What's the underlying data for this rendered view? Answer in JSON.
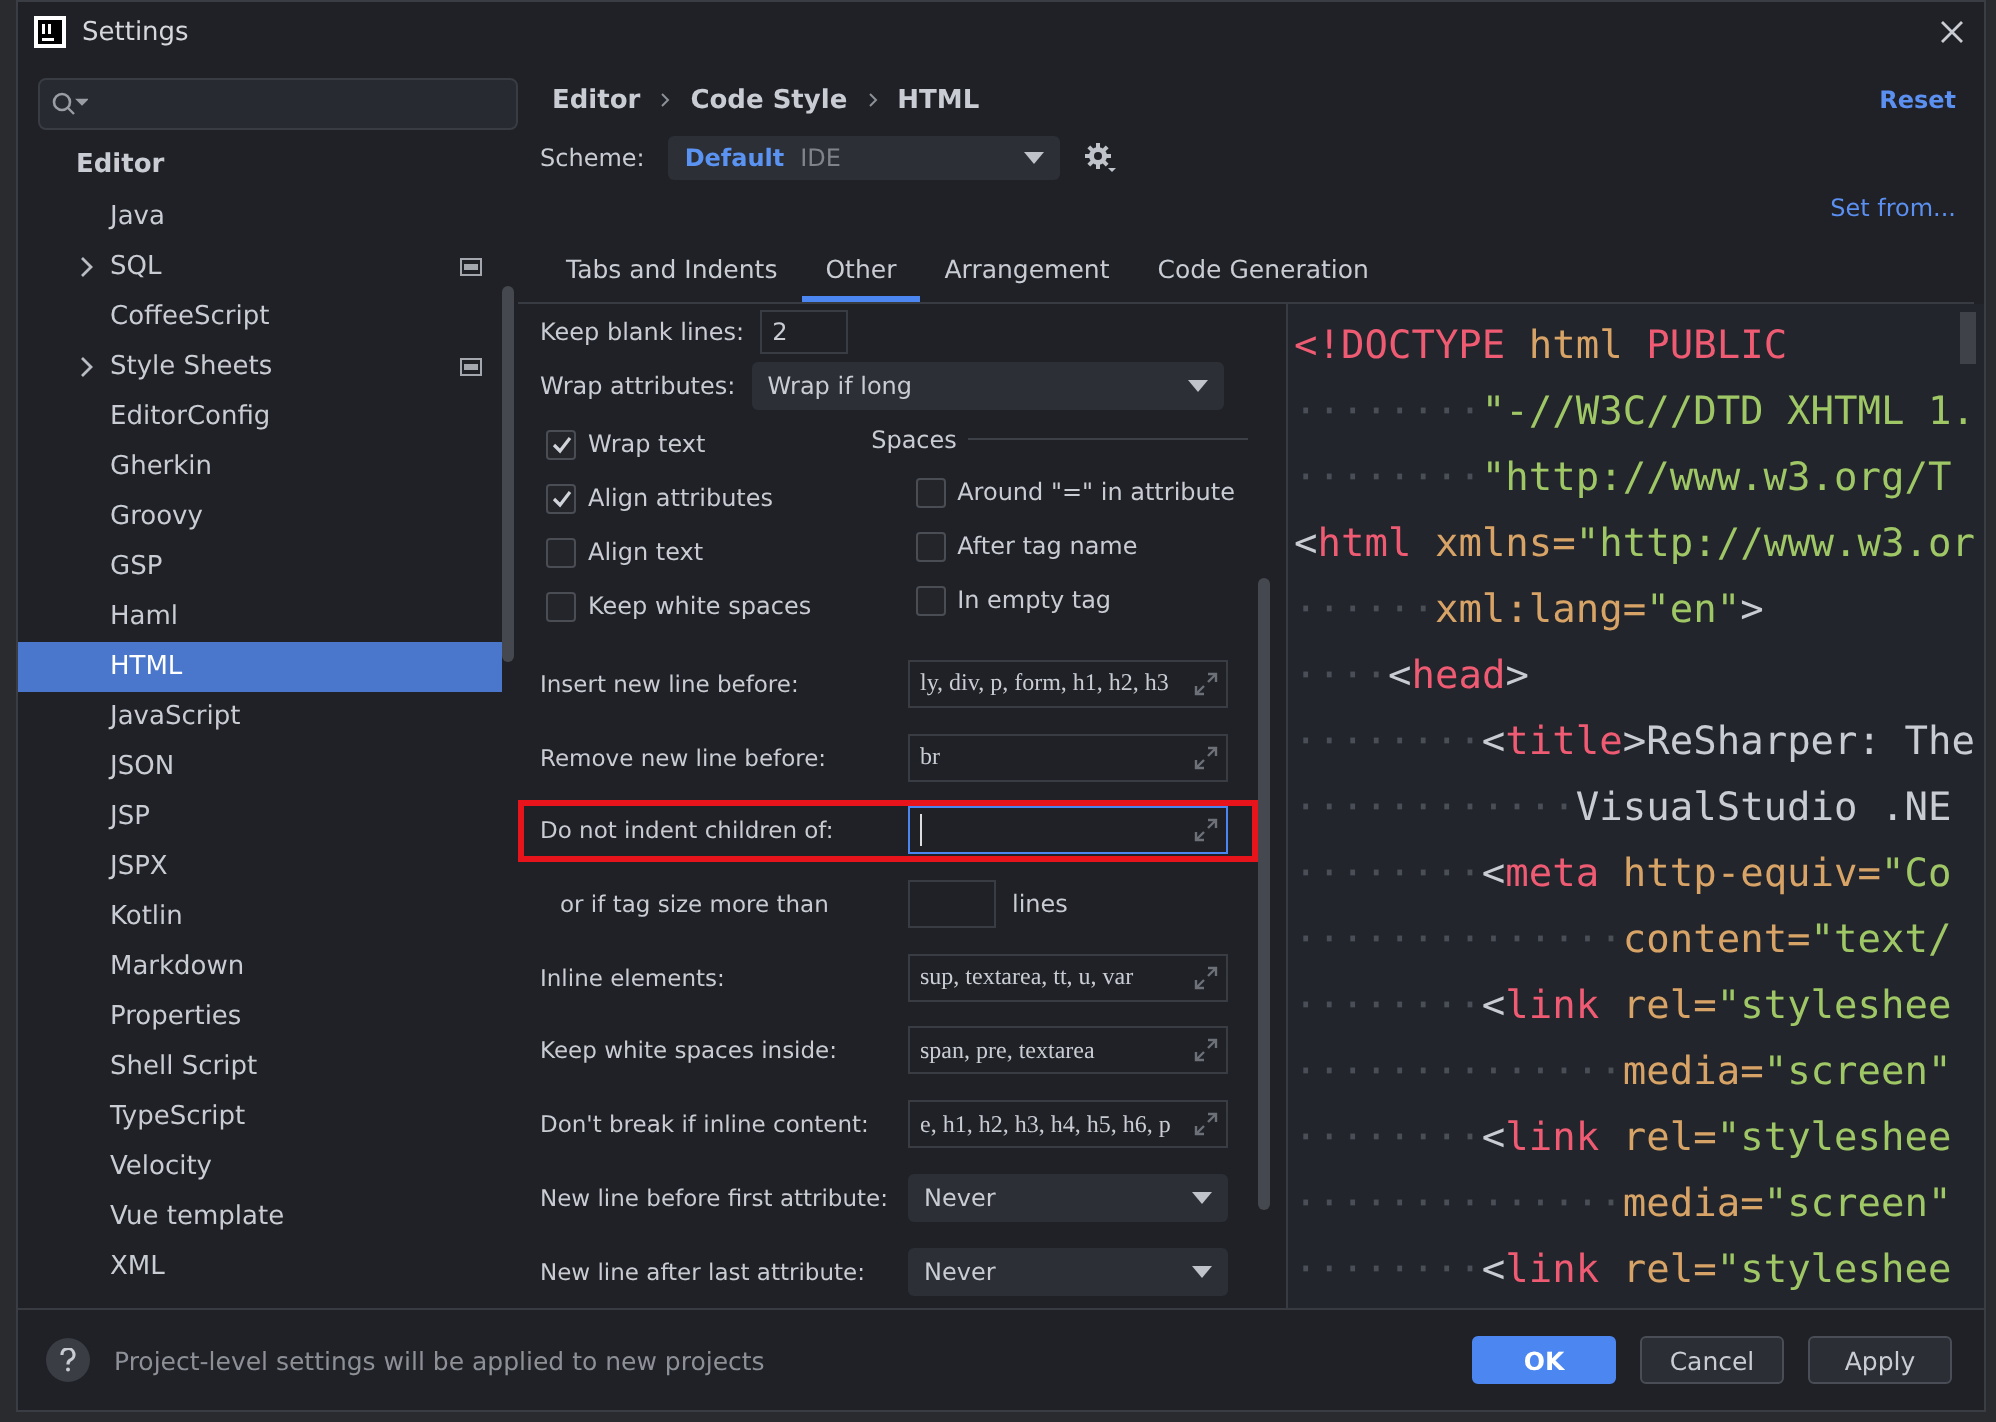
{
  "window": {
    "title": "Settings"
  },
  "sidebar": {
    "section": "Editor",
    "items": [
      {
        "label": "Java",
        "expandable": false,
        "project_scoped": false,
        "selected": false
      },
      {
        "label": "SQL",
        "expandable": true,
        "project_scoped": true,
        "selected": false
      },
      {
        "label": "CoffeeScript",
        "expandable": false,
        "project_scoped": false,
        "selected": false
      },
      {
        "label": "Style Sheets",
        "expandable": true,
        "project_scoped": true,
        "selected": false
      },
      {
        "label": "EditorConfig",
        "expandable": false,
        "project_scoped": false,
        "selected": false
      },
      {
        "label": "Gherkin",
        "expandable": false,
        "project_scoped": false,
        "selected": false
      },
      {
        "label": "Groovy",
        "expandable": false,
        "project_scoped": false,
        "selected": false
      },
      {
        "label": "GSP",
        "expandable": false,
        "project_scoped": false,
        "selected": false
      },
      {
        "label": "Haml",
        "expandable": false,
        "project_scoped": false,
        "selected": false
      },
      {
        "label": "HTML",
        "expandable": false,
        "project_scoped": false,
        "selected": true
      },
      {
        "label": "JavaScript",
        "expandable": false,
        "project_scoped": false,
        "selected": false
      },
      {
        "label": "JSON",
        "expandable": false,
        "project_scoped": false,
        "selected": false
      },
      {
        "label": "JSP",
        "expandable": false,
        "project_scoped": false,
        "selected": false
      },
      {
        "label": "JSPX",
        "expandable": false,
        "project_scoped": false,
        "selected": false
      },
      {
        "label": "Kotlin",
        "expandable": false,
        "project_scoped": false,
        "selected": false
      },
      {
        "label": "Markdown",
        "expandable": false,
        "project_scoped": false,
        "selected": false
      },
      {
        "label": "Properties",
        "expandable": false,
        "project_scoped": false,
        "selected": false
      },
      {
        "label": "Shell Script",
        "expandable": false,
        "project_scoped": false,
        "selected": false
      },
      {
        "label": "TypeScript",
        "expandable": false,
        "project_scoped": false,
        "selected": false
      },
      {
        "label": "Velocity",
        "expandable": false,
        "project_scoped": false,
        "selected": false
      },
      {
        "label": "Vue template",
        "expandable": false,
        "project_scoped": false,
        "selected": false
      },
      {
        "label": "XML",
        "expandable": false,
        "project_scoped": false,
        "selected": false
      }
    ]
  },
  "breadcrumb": [
    "Editor",
    "Code Style",
    "HTML"
  ],
  "reset": "Reset",
  "scheme": {
    "label": "Scheme:",
    "name": "Default",
    "scope": "IDE"
  },
  "set_from": "Set from...",
  "tabs": [
    {
      "label": "Tabs and Indents",
      "selected": false
    },
    {
      "label": "Other",
      "selected": true
    },
    {
      "label": "Arrangement",
      "selected": false
    },
    {
      "label": "Code Generation",
      "selected": false
    }
  ],
  "keep_blank_lines": {
    "label": "Keep blank lines:",
    "value": "2"
  },
  "wrap_attributes": {
    "label": "Wrap attributes:",
    "value": "Wrap if long"
  },
  "options": [
    {
      "label": "Wrap text",
      "checked": true
    },
    {
      "label": "Align attributes",
      "checked": true
    },
    {
      "label": "Align text",
      "checked": false
    },
    {
      "label": "Keep white spaces",
      "checked": false
    }
  ],
  "spaces": {
    "title": "Spaces",
    "options": [
      {
        "label": "Around \"=\" in attribute",
        "checked": false
      },
      {
        "label": "After tag name",
        "checked": false
      },
      {
        "label": "In empty tag",
        "checked": false
      }
    ]
  },
  "rows": [
    {
      "kind": "text",
      "label": "Insert new line before:",
      "value": "ly, div, p, form, h1, h2, h3",
      "highlighted": false,
      "focused": false
    },
    {
      "kind": "text",
      "label": "Remove new line before:",
      "value": "br",
      "highlighted": false,
      "focused": false
    },
    {
      "kind": "text",
      "label": "Do not indent children of:",
      "value": "",
      "highlighted": true,
      "focused": true
    },
    {
      "kind": "size",
      "label": "or if tag size more than",
      "unit": "lines",
      "highlighted": false
    },
    {
      "kind": "text",
      "label": "Inline elements:",
      "value": "sup, textarea, tt, u, var",
      "highlighted": false,
      "focused": false
    },
    {
      "kind": "text",
      "label": "Keep white spaces inside:",
      "value": "span, pre, textarea",
      "highlighted": false,
      "focused": false
    },
    {
      "kind": "text",
      "label": "Don't break if inline content:",
      "value": "e, h1, h2, h3, h4, h5, h6, p",
      "highlighted": false,
      "focused": false
    },
    {
      "kind": "dropdown",
      "label": "New line before first attribute:",
      "value": "Never",
      "highlighted": false
    },
    {
      "kind": "dropdown",
      "label": "New line after last attribute:",
      "value": "Never",
      "highlighted": false
    }
  ],
  "preview": [
    [
      {
        "kind": "tag",
        "text": "<!DOCTYPE"
      },
      {
        "kind": "attr",
        "text": " html"
      },
      {
        "kind": "tag",
        "text": " PUBLIC"
      }
    ],
    [
      {
        "kind": "space",
        "text": "········"
      },
      {
        "kind": "str",
        "text": "\"-//W3C//DTD XHTML 1."
      }
    ],
    [
      {
        "kind": "space",
        "text": "········"
      },
      {
        "kind": "str",
        "text": "\"http://www.w3.org/T"
      }
    ],
    [
      {
        "kind": "punct",
        "text": "<"
      },
      {
        "kind": "tag",
        "text": "html"
      },
      {
        "kind": "attr",
        "text": " xmlns="
      },
      {
        "kind": "str",
        "text": "\"http://www.w3.or"
      }
    ],
    [
      {
        "kind": "space",
        "text": "······"
      },
      {
        "kind": "attr",
        "text": "xml:lang="
      },
      {
        "kind": "str",
        "text": "\"en\""
      },
      {
        "kind": "punct",
        "text": ">"
      }
    ],
    [
      {
        "kind": "space",
        "text": "····"
      },
      {
        "kind": "punct",
        "text": "<"
      },
      {
        "kind": "tag",
        "text": "head"
      },
      {
        "kind": "punct",
        "text": ">"
      }
    ],
    [
      {
        "kind": "space",
        "text": "········"
      },
      {
        "kind": "punct",
        "text": "<"
      },
      {
        "kind": "tag",
        "text": "title"
      },
      {
        "kind": "punct",
        "text": ">"
      },
      {
        "kind": "text",
        "text": "ReSharper: The"
      }
    ],
    [
      {
        "kind": "space",
        "text": "············"
      },
      {
        "kind": "text",
        "text": "VisualStudio .NE"
      }
    ],
    [
      {
        "kind": "space",
        "text": "········"
      },
      {
        "kind": "punct",
        "text": "<"
      },
      {
        "kind": "tag",
        "text": "meta"
      },
      {
        "kind": "attr",
        "text": " http-equiv="
      },
      {
        "kind": "str",
        "text": "\"Co"
      }
    ],
    [
      {
        "kind": "space",
        "text": "··············"
      },
      {
        "kind": "attr",
        "text": "content="
      },
      {
        "kind": "str",
        "text": "\"text/"
      }
    ],
    [
      {
        "kind": "space",
        "text": "········"
      },
      {
        "kind": "punct",
        "text": "<"
      },
      {
        "kind": "tag",
        "text": "link"
      },
      {
        "kind": "attr",
        "text": " rel="
      },
      {
        "kind": "str",
        "text": "\"styleshee"
      }
    ],
    [
      {
        "kind": "space",
        "text": "··············"
      },
      {
        "kind": "attr",
        "text": "media="
      },
      {
        "kind": "str",
        "text": "\"screen\""
      }
    ],
    [
      {
        "kind": "space",
        "text": "········"
      },
      {
        "kind": "punct",
        "text": "<"
      },
      {
        "kind": "tag",
        "text": "link"
      },
      {
        "kind": "attr",
        "text": " rel="
      },
      {
        "kind": "str",
        "text": "\"styleshee"
      }
    ],
    [
      {
        "kind": "space",
        "text": "··············"
      },
      {
        "kind": "attr",
        "text": "media="
      },
      {
        "kind": "str",
        "text": "\"screen\""
      }
    ],
    [
      {
        "kind": "space",
        "text": "········"
      },
      {
        "kind": "punct",
        "text": "<"
      },
      {
        "kind": "tag",
        "text": "link"
      },
      {
        "kind": "attr",
        "text": " rel="
      },
      {
        "kind": "str",
        "text": "\"styleshee"
      }
    ]
  ],
  "footer": {
    "hint": "Project-level settings will be applied to new projects",
    "buttons": [
      {
        "label": "OK",
        "primary": true
      },
      {
        "label": "Cancel",
        "primary": false
      },
      {
        "label": "Apply",
        "primary": false
      }
    ]
  }
}
